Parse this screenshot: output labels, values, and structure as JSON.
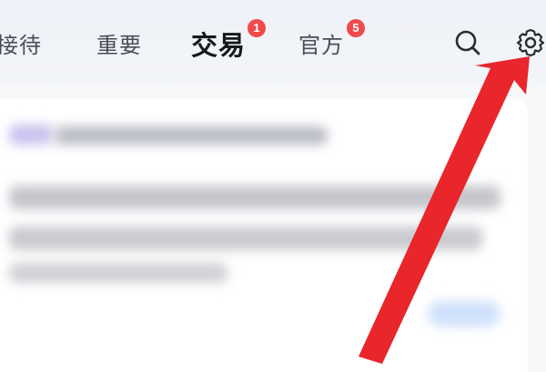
{
  "tabs": {
    "jiedai": {
      "label": "接待"
    },
    "zhongyao": {
      "label": "重要"
    },
    "jiaoyi": {
      "label": "交易",
      "badge": "1"
    },
    "guanfang": {
      "label": "官方",
      "badge": "5"
    }
  },
  "active_tab": "jiaoyi",
  "icons": {
    "search": "search-icon",
    "settings": "gear-icon"
  },
  "colors": {
    "badge": "#ef4b4b",
    "arrow": "#e8262b",
    "active_text": "#16181d",
    "inactive_text": "#4a4d55"
  }
}
